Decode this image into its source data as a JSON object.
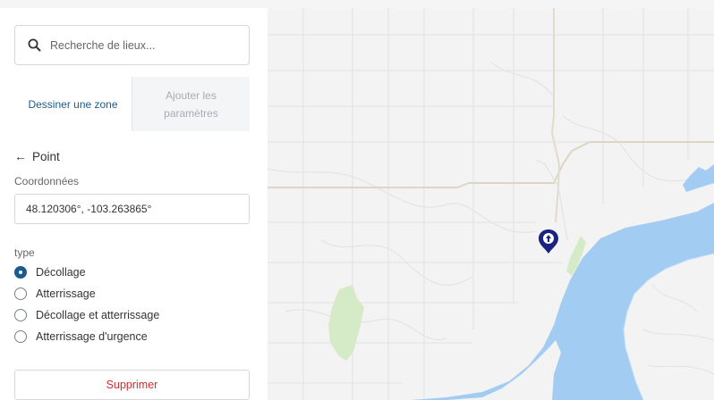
{
  "search": {
    "placeholder": "Recherche de lieux..."
  },
  "tabs": [
    {
      "label": "Dessiner une zone",
      "active": true
    },
    {
      "label": "Ajouter les paramètres",
      "active": false
    }
  ],
  "point": {
    "back_label": "Point",
    "coords_label": "Coordonnées",
    "coords_value": "48.120306°, -103.263865°"
  },
  "type": {
    "label": "type",
    "options": [
      {
        "label": "Décollage",
        "selected": true
      },
      {
        "label": "Atterrissage",
        "selected": false
      },
      {
        "label": "Décollage et atterrissage",
        "selected": false
      },
      {
        "label": "Atterrissage d'urgence",
        "selected": false
      }
    ]
  },
  "delete_label": "Supprimer",
  "icons": {
    "search": "search-icon",
    "back": "arrow-left-icon",
    "marker": "takeoff-marker-icon"
  },
  "colors": {
    "accent": "#1b5c8f",
    "danger": "#d32f2f",
    "water": "#a3ccf2",
    "park": "#d5ebc7",
    "marker": "#1a237e"
  }
}
